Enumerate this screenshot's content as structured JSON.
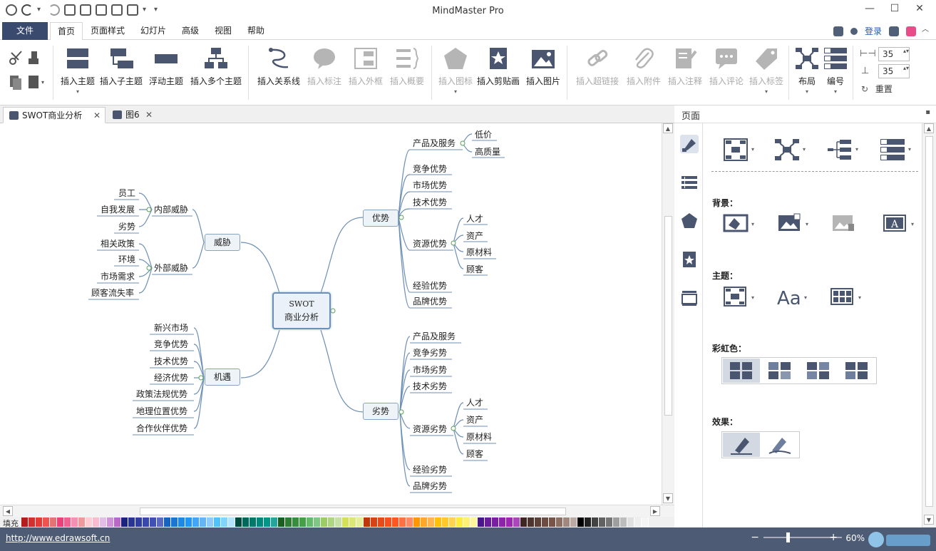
{
  "app": {
    "title": "MindMaster Pro"
  },
  "menu": {
    "file": "文件",
    "tabs": [
      "首页",
      "页面样式",
      "幻灯片",
      "高级",
      "视图",
      "帮助"
    ],
    "login": "登录"
  },
  "ribbon": {
    "insert_topic": "插入主题",
    "insert_subtopic": "插入子主题",
    "floating_topic": "浮动主题",
    "insert_multiple": "插入多个主题",
    "insert_relation": "插入关系线",
    "insert_callout": "插入标注",
    "insert_boundary": "插入外框",
    "insert_summary": "插入概要",
    "insert_icon": "插入图标",
    "insert_clipart": "插入剪贴画",
    "insert_image": "插入图片",
    "insert_hyperlink": "插入超链接",
    "insert_attachment": "插入附件",
    "insert_note": "插入注释",
    "insert_comment": "插入评论",
    "insert_tag": "插入标签",
    "layout": "布局",
    "numbering": "编号",
    "spacing_h": "35",
    "spacing_v": "35",
    "reset": "重置"
  },
  "doc_tabs": [
    {
      "label": "SWOT商业分析"
    },
    {
      "label": "图6"
    }
  ],
  "mindmap": {
    "center_line1": "SWOT",
    "center_line2": "商业分析",
    "strengths": {
      "label": "优势",
      "products": "产品及服务",
      "products_children": [
        "低价",
        "高质量"
      ],
      "items": [
        "竞争优势",
        "市场优势",
        "技术优势"
      ],
      "resources": "资源优势",
      "resources_children": [
        "人才",
        "资产",
        "原材料",
        "顾客"
      ],
      "tail": [
        "经验优势",
        "品牌优势"
      ]
    },
    "weaknesses": {
      "label": "劣势",
      "items": [
        "产品及服务",
        "竞争劣势",
        "市场劣势",
        "技术劣势"
      ],
      "resources": "资源劣势",
      "resources_children": [
        "人才",
        "资产",
        "原材料",
        "顾客"
      ],
      "tail": [
        "经验劣势",
        "品牌劣势"
      ]
    },
    "threats": {
      "label": "威胁",
      "internal": "内部威胁",
      "internal_children": [
        "员工",
        "自我发展",
        "劣势"
      ],
      "external": "外部威胁",
      "external_children": [
        "相关政策",
        "环境",
        "市场需求",
        "顾客流失率"
      ]
    },
    "opportunities": {
      "label": "机遇",
      "children": [
        "新兴市场",
        "竞争优势",
        "技术优势",
        "经济优势",
        "政策法规优势",
        "地理位置优势",
        "合作伙伴优势"
      ]
    }
  },
  "palette": {
    "label": "填充"
  },
  "status": {
    "url": "http://www.edrawsoft.cn",
    "zoom": "60%"
  },
  "panel": {
    "title": "页面",
    "background": "背景：",
    "theme": "主题：",
    "rainbow": "彩虹色：",
    "effect": "效果："
  },
  "colors": {
    "accent": "#3a4a6e",
    "status_bar": "#4e5b74",
    "line": "#6c8fb5"
  }
}
